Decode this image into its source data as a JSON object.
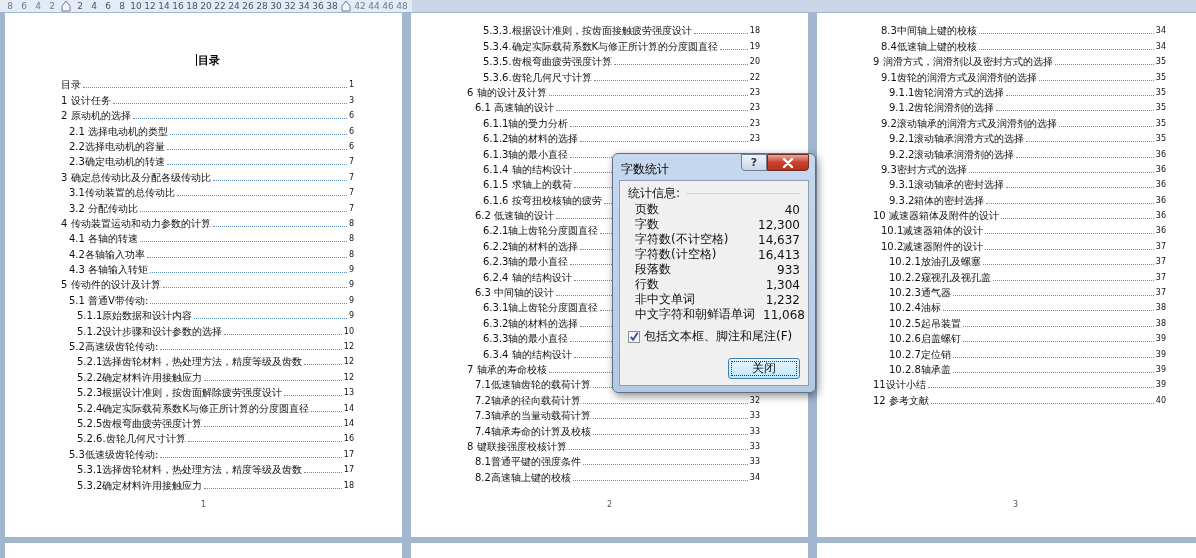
{
  "ruler": {
    "left_numbers": [
      "8",
      "6",
      "4",
      "2"
    ],
    "numbers": [
      "2",
      "4",
      "6",
      "8",
      "10",
      "12",
      "14",
      "16",
      "18",
      "20",
      "22",
      "24",
      "26",
      "28",
      "30",
      "32",
      "34",
      "36",
      "38"
    ],
    "right_numbers": [
      "42",
      "44",
      "46",
      "48"
    ]
  },
  "pages": [
    {
      "title": "目录",
      "footer": "1",
      "entries": [
        {
          "text": "目录",
          "page": "1"
        },
        {
          "text": "1 设计任务",
          "page": "3"
        },
        {
          "text": "2 原动机的选择",
          "page": "6",
          "children": [
            {
              "text": "2.1 选择电动机的类型",
              "page": "6"
            },
            {
              "text": "2.2选择电动机的容量",
              "page": "6"
            },
            {
              "text": "2.3确定电动机的转速",
              "page": "7"
            }
          ]
        },
        {
          "text": "3 确定总传动比及分配各级传动比",
          "page": "7",
          "children": [
            {
              "text": "3.1传动装置的总传动比",
              "page": "7"
            },
            {
              "text": "3.2 分配传动比",
              "page": "7"
            }
          ]
        },
        {
          "text": "4 传动装置运动和动力参数的计算",
          "page": "8",
          "children": [
            {
              "text": "4.1 各轴的转速",
              "page": "8"
            },
            {
              "text": "4.2各轴输入功率",
              "page": "8"
            },
            {
              "text": "4.3 各轴输入转矩",
              "page": "9"
            }
          ]
        },
        {
          "text": "5 传动件的设计及计算",
          "page": "9",
          "children": [
            {
              "text": "5.1 普通V带传动:",
              "page": "9",
              "children": [
                {
                  "text": "5.1.1原始数据和设计内容",
                  "page": "9"
                },
                {
                  "text": "5.1.2设计步骤和设计参数的选择",
                  "page": "10"
                }
              ]
            },
            {
              "text": "5.2高速级齿轮传动:",
              "page": "12",
              "children": [
                {
                  "text": "5.2.1选择齿轮材料，热处理方法，精度等级及齿数",
                  "page": "12"
                },
                {
                  "text": "5.2.2确定材料许用接触应力",
                  "page": "12"
                },
                {
                  "text": "5.2.3根据设计准则，按齿面解除疲劳强度设计",
                  "page": "13"
                },
                {
                  "text": "5.2.4确定实际载荷系数K与修正所计算的分度圆直径",
                  "page": "14"
                },
                {
                  "text": "5.2.5齿根弯曲疲劳强度计算",
                  "page": "14"
                },
                {
                  "text": "5.2.6.齿轮几何尺寸计算",
                  "page": "16"
                }
              ]
            },
            {
              "text": "5.3低速级齿轮传动:",
              "page": "17",
              "children": [
                {
                  "text": "5.3.1选择齿轮材料，热处理方法，精度等级及齿数",
                  "page": "17"
                },
                {
                  "text": "5.3.2确定材料许用接触应力",
                  "page": "18"
                }
              ]
            }
          ]
        }
      ]
    },
    {
      "footer": "2",
      "entries": [
        {
          "children": [
            {
              "children": [
                {
                  "text": "5.3.3.根据设计准则，按齿面接触疲劳强度设计",
                  "page": "18"
                },
                {
                  "text": "5.3.4.确定实际载荷系数K与修正所计算的分度圆直径",
                  "page": "19"
                },
                {
                  "text": "5.3.5.齿根弯曲疲劳强度计算",
                  "page": "20"
                },
                {
                  "text": "5.3.6.齿轮几何尺寸计算",
                  "page": "22"
                }
              ]
            }
          ]
        },
        {
          "text": "6 轴的设计及计算",
          "page": "23",
          "children": [
            {
              "text": "6.1 高速轴的设计",
              "page": "23",
              "children": [
                {
                  "text": "6.1.1轴的受力分析",
                  "page": "23"
                },
                {
                  "text": "6.1.2轴的材料的选择",
                  "page": "23"
                },
                {
                  "text": "6.1.3轴的最小直径"
                },
                {
                  "text": "6.1.4 轴的结构设计"
                },
                {
                  "text": "6.1.5 求轴上的载荷"
                },
                {
                  "text": "6.1.6 按弯扭校核轴的疲劳"
                }
              ]
            },
            {
              "text": "6.2 低速轴的设计",
              "children": [
                {
                  "text": "6.2.1轴上齿轮分度圆直径"
                },
                {
                  "text": "6.2.2轴的材料的选择"
                },
                {
                  "text": "6.2.3轴的最小直径"
                },
                {
                  "text": "6.2.4 轴的结构设计"
                }
              ]
            },
            {
              "text": "6.3 中间轴的设计",
              "children": [
                {
                  "text": "6.3.1轴上齿轮分度圆直径"
                },
                {
                  "text": "6.3.2轴的材料的选择"
                },
                {
                  "text": "6.3.3轴的最小直径"
                },
                {
                  "text": "6.3.4 轴的结构设计"
                }
              ]
            }
          ]
        },
        {
          "text": "7 轴承的寿命校核",
          "children": [
            {
              "text": "7.1低速轴齿轮的载荷计算"
            },
            {
              "text": "7.2轴承的径向载荷计算",
              "page": "32"
            },
            {
              "text": "7.3轴承的当量动载荷计算",
              "page": "33"
            },
            {
              "text": "7.4轴承寿命的计算及校核",
              "page": "33"
            }
          ]
        },
        {
          "text": "8 键联接强度校核计算",
          "page": "33",
          "children": [
            {
              "text": "8.1普通平键的强度条件",
              "page": "33"
            },
            {
              "text": "8.2高速轴上键的校核",
              "page": "34"
            }
          ]
        }
      ]
    },
    {
      "footer": "3",
      "entries": [
        {
          "children": [
            {
              "text": "8.3中间轴上键的校核",
              "page": "34"
            },
            {
              "text": "8.4低速轴上键的校核",
              "page": "34"
            }
          ]
        },
        {
          "text": "9 润滑方式，润滑剂以及密封方式的选择",
          "page": "35",
          "children": [
            {
              "text": "9.1齿轮的润滑方式及润滑剂的选择",
              "page": "35",
              "children": [
                {
                  "text": "9.1.1齿轮润滑方式的选择",
                  "page": "35"
                },
                {
                  "text": "9.1.2齿轮润滑剂的选择",
                  "page": "35"
                }
              ]
            },
            {
              "text": "9.2滚动轴承的润滑方式及润滑剂的选择",
              "page": "35",
              "children": [
                {
                  "text": "9.2.1滚动轴承润滑方式的选择",
                  "page": "35"
                },
                {
                  "text": "9.2.2滚动轴承润滑剂的选择",
                  "page": "36"
                }
              ]
            },
            {
              "text": "9.3密封方式的选择",
              "page": "36",
              "children": [
                {
                  "text": "9.3.1滚动轴承的密封选择",
                  "page": "36"
                },
                {
                  "text": "9.3.2箱体的密封选择",
                  "page": "36"
                }
              ]
            }
          ]
        },
        {
          "text": "10 减速器箱体及附件的设计",
          "page": "36",
          "children": [
            {
              "text": "10.1减速器箱体的设计",
              "page": "36"
            },
            {
              "text": "10.2减速器附件的设计",
              "page": "37",
              "children": [
                {
                  "text": "10.2.1放油孔及螺塞",
                  "page": "37"
                },
                {
                  "text": "10.2.2窥视孔及视孔盖",
                  "page": "37"
                },
                {
                  "text": "10.2.3通气器",
                  "page": "37"
                },
                {
                  "text": "10.2.4油标",
                  "page": "38"
                },
                {
                  "text": "10.2.5起吊装置",
                  "page": "38"
                },
                {
                  "text": "10.2.6启盖螺钉",
                  "page": "39"
                },
                {
                  "text": "10.2.7定位销",
                  "page": "39"
                },
                {
                  "text": "10.2.8轴承盖",
                  "page": "39"
                }
              ]
            }
          ]
        },
        {
          "text": "11设计小结",
          "page": "39"
        },
        {
          "text": "12 参考文献",
          "page": "40"
        }
      ]
    }
  ],
  "dialog": {
    "title": "字数统计",
    "help": "?",
    "group": "统计信息:",
    "stats": [
      {
        "label": "页数",
        "value": "40"
      },
      {
        "label": "字数",
        "value": "12,300"
      },
      {
        "label": "字符数(不计空格)",
        "value": "14,637"
      },
      {
        "label": "字符数(计空格)",
        "value": "16,413"
      },
      {
        "label": "段落数",
        "value": "933"
      },
      {
        "label": "行数",
        "value": "1,304"
      },
      {
        "label": "非中文单词",
        "value": "1,232"
      },
      {
        "label": "中文字符和朝鲜语单词",
        "value": "11,068"
      }
    ],
    "checkbox": {
      "label": "包括文本框、脚注和尾注(F)",
      "checked": true
    },
    "button": "关闭"
  }
}
